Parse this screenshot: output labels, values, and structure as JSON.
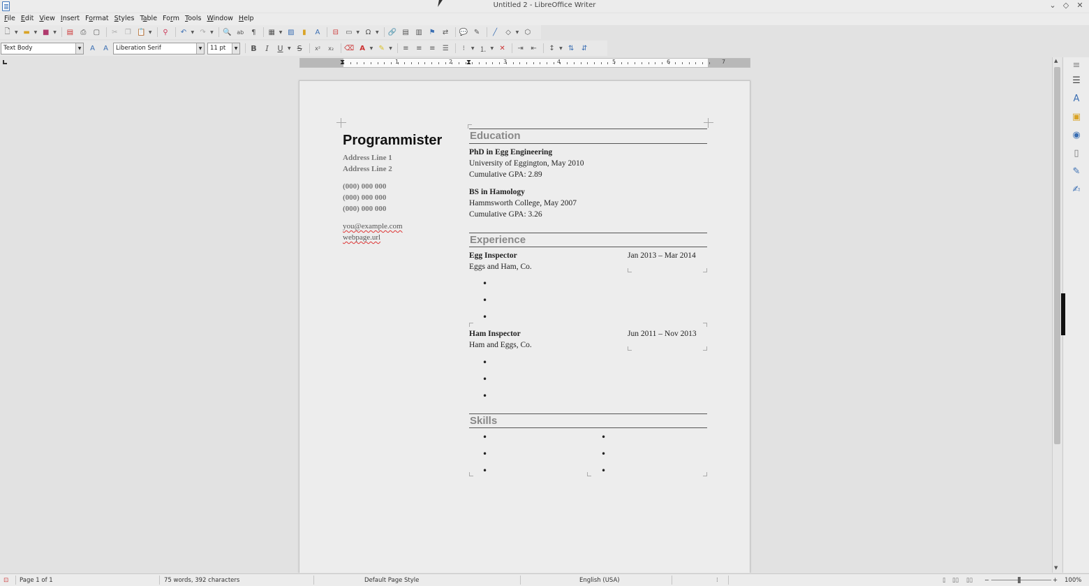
{
  "window": {
    "title": "Untitled 2 - LibreOffice Writer"
  },
  "menu": [
    {
      "pre": "",
      "u": "F",
      "post": "ile"
    },
    {
      "pre": "",
      "u": "E",
      "post": "dit"
    },
    {
      "pre": "",
      "u": "V",
      "post": "iew"
    },
    {
      "pre": "",
      "u": "I",
      "post": "nsert"
    },
    {
      "pre": "F",
      "u": "o",
      "post": "rmat"
    },
    {
      "pre": "",
      "u": "S",
      "post": "tyles"
    },
    {
      "pre": "T",
      "u": "a",
      "post": "ble"
    },
    {
      "pre": "Fo",
      "u": "r",
      "post": "m"
    },
    {
      "pre": "",
      "u": "T",
      "post": "ools"
    },
    {
      "pre": "",
      "u": "W",
      "post": "indow"
    },
    {
      "pre": "",
      "u": "H",
      "post": "elp"
    }
  ],
  "formatting": {
    "paragraph_style": "Text Body",
    "font_name": "Liberation Serif",
    "font_size": "11 pt"
  },
  "ruler": {
    "numbers": [
      "1",
      "1",
      "2",
      "3",
      "4",
      "5",
      "6",
      "7"
    ]
  },
  "document": {
    "name": "Programmister",
    "address": [
      "Address Line 1",
      "Address Line 2"
    ],
    "phones": [
      "(000) 000 000",
      "(000) 000 000",
      "(000) 000 000"
    ],
    "email": "you@example.com",
    "webpage": "webpage.url",
    "education": {
      "heading": "Education",
      "entries": [
        {
          "degree": "PhD in Egg Engineering",
          "school": "University of Eggington, May 2010",
          "gpa": "Cumulative GPA: 2.89"
        },
        {
          "degree": "BS in Hamology",
          "school": "Hammsworth College, May 2007",
          "gpa": "Cumulative GPA: 3.26"
        }
      ]
    },
    "experience": {
      "heading": "Experience",
      "jobs": [
        {
          "title": "Egg Inspector",
          "company": "Eggs and Ham, Co.",
          "dates": "Jan 2013 – Mar 2014"
        },
        {
          "title": "Ham Inspector",
          "company": "Ham and Eggs, Co.",
          "dates": "Jun 2011 – Nov 2013"
        }
      ]
    },
    "skills": {
      "heading": "Skills"
    }
  },
  "status": {
    "page": "Page 1 of 1",
    "words": "75 words, 392 characters",
    "page_style": "Default Page Style",
    "language": "English (USA)",
    "zoom": "100%"
  },
  "colors": {
    "accent": "#3b6fb3",
    "heading_gray": "#888888",
    "spell_error": "#dd3333"
  }
}
